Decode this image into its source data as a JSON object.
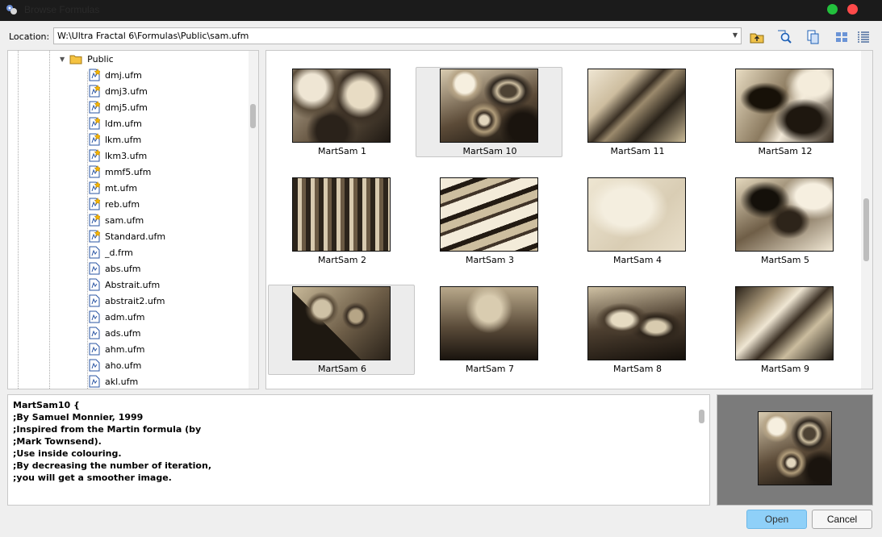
{
  "window": {
    "title": "Browse Formulas",
    "controls": {
      "maximize_color": "#22c03c",
      "close_color": "#ff4a4a"
    }
  },
  "location": {
    "label": "Location:",
    "value": "W:\\Ultra Fractal 6\\Formulas\\Public\\sam.ufm"
  },
  "toolbar": {
    "icons": [
      "up-folder-icon",
      "find-icon",
      "copy-icon",
      "large-icons-view-icon",
      "details-view-icon"
    ]
  },
  "tree": {
    "folder": {
      "label": "Public",
      "expanded": true
    },
    "files": [
      {
        "label": "dmj.ufm",
        "starred": true
      },
      {
        "label": "dmj3.ufm",
        "starred": true
      },
      {
        "label": "dmj5.ufm",
        "starred": true
      },
      {
        "label": "ldm.ufm",
        "starred": true
      },
      {
        "label": "lkm.ufm",
        "starred": true
      },
      {
        "label": "lkm3.ufm",
        "starred": true
      },
      {
        "label": "mmf5.ufm",
        "starred": true
      },
      {
        "label": "mt.ufm",
        "starred": true
      },
      {
        "label": "reb.ufm",
        "starred": true
      },
      {
        "label": "sam.ufm",
        "starred": true
      },
      {
        "label": "Standard.ufm",
        "starred": true
      },
      {
        "label": "_d.frm",
        "starred": false
      },
      {
        "label": "abs.ufm",
        "starred": false
      },
      {
        "label": "Abstrait.ufm",
        "starred": false
      },
      {
        "label": "abstrait2.ufm",
        "starred": false
      },
      {
        "label": "adm.ufm",
        "starred": false
      },
      {
        "label": "ads.ufm",
        "starred": false
      },
      {
        "label": "ahm.ufm",
        "starred": false
      },
      {
        "label": "aho.ufm",
        "starred": false
      },
      {
        "label": "akl.ufm",
        "starred": false
      }
    ]
  },
  "thumbnails": [
    {
      "label": "MartSam 1",
      "style": "a",
      "selected": false
    },
    {
      "label": "MartSam 10",
      "style": "b",
      "selected": true
    },
    {
      "label": "MartSam 11",
      "style": "c",
      "selected": false
    },
    {
      "label": "MartSam 12",
      "style": "d",
      "selected": false
    },
    {
      "label": "MartSam 2",
      "style": "e",
      "selected": false
    },
    {
      "label": "MartSam 3",
      "style": "f",
      "selected": false
    },
    {
      "label": "MartSam 4",
      "style": "g",
      "selected": false
    },
    {
      "label": "MartSam 5",
      "style": "h",
      "selected": false
    },
    {
      "label": "MartSam 6",
      "style": "i",
      "selected": true
    },
    {
      "label": "MartSam 7",
      "style": "j",
      "selected": false
    },
    {
      "label": "MartSam 8",
      "style": "k",
      "selected": false
    },
    {
      "label": "MartSam 9",
      "style": "l",
      "selected": false
    }
  ],
  "description": {
    "lines": [
      "MartSam10 {",
      ";By Samuel Monnier, 1999",
      ";Inspired from the Martin formula (by",
      ";Mark Townsend).",
      ";Use inside colouring.",
      ";By decreasing the number of iteration,",
      ";you will get a smoother image."
    ]
  },
  "preview": {
    "style": "b"
  },
  "buttons": {
    "open": "Open",
    "cancel": "Cancel"
  },
  "colors": {
    "accent": "#8fd0f8",
    "selection": "#ececec"
  }
}
